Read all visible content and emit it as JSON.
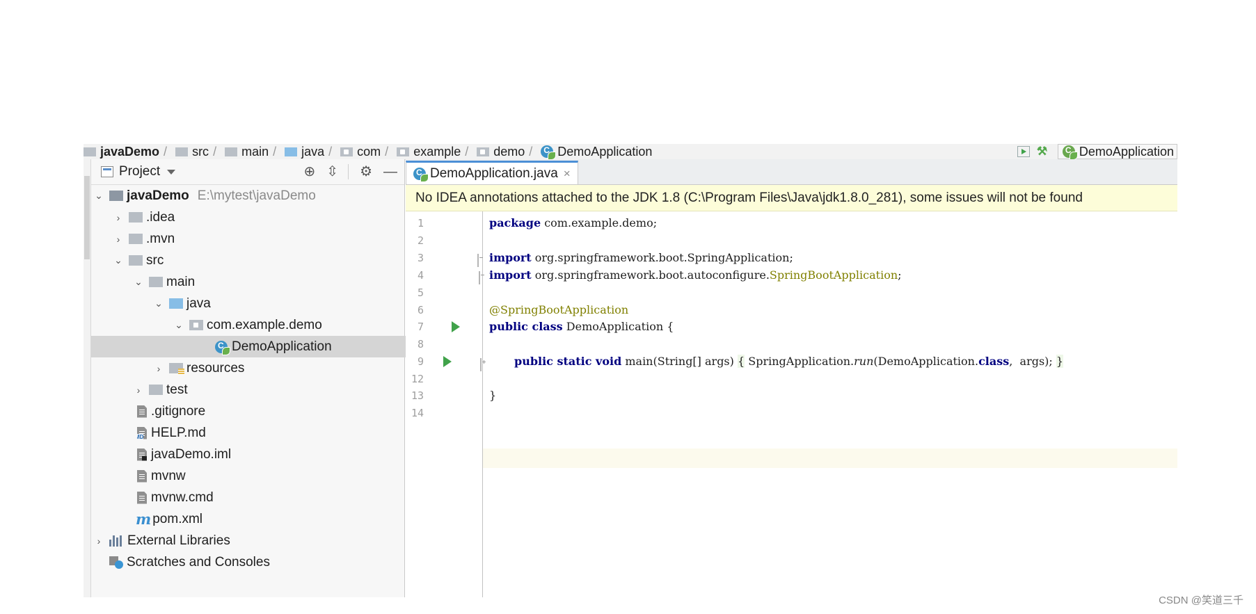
{
  "breadcrumb": {
    "items": [
      "javaDemo",
      "src",
      "main",
      "java",
      "com",
      "example",
      "demo",
      "DemoApplication"
    ],
    "run_config": "DemoApplication"
  },
  "project": {
    "title": "Project",
    "tree": [
      {
        "label": "javaDemo",
        "path": "E:\\mytest\\javaDemo"
      },
      {
        "label": ".idea"
      },
      {
        "label": ".mvn"
      },
      {
        "label": "src"
      },
      {
        "label": "main"
      },
      {
        "label": "java"
      },
      {
        "label": "com.example.demo"
      },
      {
        "label": "DemoApplication"
      },
      {
        "label": "resources"
      },
      {
        "label": "test"
      },
      {
        "label": ".gitignore"
      },
      {
        "label": "HELP.md"
      },
      {
        "label": "javaDemo.iml"
      },
      {
        "label": "mvnw"
      },
      {
        "label": "mvnw.cmd"
      },
      {
        "label": "pom.xml"
      },
      {
        "label": "External Libraries"
      },
      {
        "label": "Scratches and Consoles"
      }
    ]
  },
  "editor": {
    "tab": "DemoApplication.java",
    "banner": "No IDEA annotations attached to the JDK 1.8 (C:\\Program Files\\Java\\jdk1.8.0_281), some issues will not be found",
    "line_numbers": [
      "1",
      "2",
      "3",
      "4",
      "5",
      "6",
      "7",
      "8",
      "9",
      "12",
      "13",
      "14"
    ],
    "code": {
      "l1_kw": "package",
      "l1_rest": " com.example.demo;",
      "l3_kw": "import",
      "l3_rest": " org.springframework.boot.SpringApplication;",
      "l4_kw": "import",
      "l4_rest": " org.springframework.boot.autoconfigure.",
      "l4_ann": "SpringBootApplication",
      "l4_end": ";",
      "l6_ann": "@SpringBootApplication",
      "l7_kw": "public class",
      "l7_rest": " DemoApplication {",
      "l9_kw": "public static void",
      "l9_a": " main(String[] args) ",
      "l9_b": "{",
      "l9_c": " SpringApplication.",
      "l9_run": "run",
      "l9_d": "(DemoApplication.",
      "l9_cls": "class",
      "l9_e": ",  args); ",
      "l9_f": "}",
      "l13": "}"
    }
  },
  "footer": "CSDN @笑道三千"
}
